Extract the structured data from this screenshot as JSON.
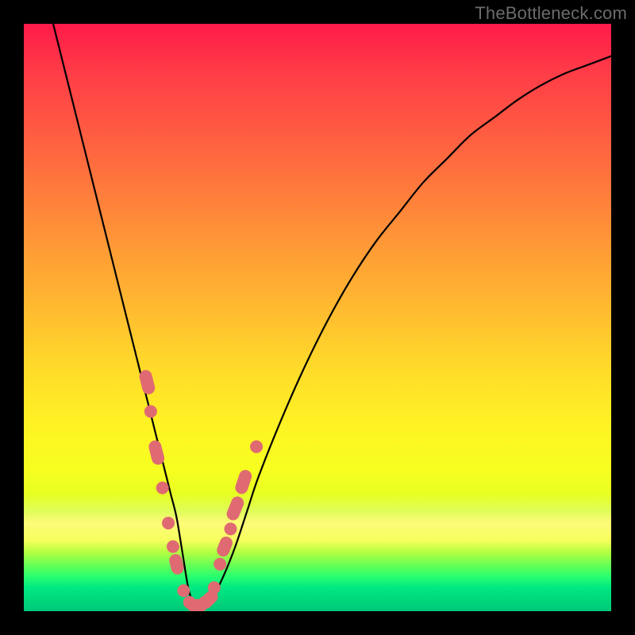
{
  "watermark": "TheBottleneck.com",
  "colors": {
    "background": "#000000",
    "gradient_top": "#ff1a4a",
    "gradient_bottom": "#00c878",
    "curve": "#000000",
    "markers": "#e06a72"
  },
  "chart_data": {
    "type": "line",
    "title": "",
    "xlabel": "",
    "ylabel": "",
    "xlim": [
      0,
      100
    ],
    "ylim": [
      0,
      100
    ],
    "grid": false,
    "series": [
      {
        "name": "curve",
        "x": [
          5,
          7,
          9,
          11,
          13,
          15,
          17,
          19,
          21,
          22,
          23,
          24,
          25,
          26,
          27,
          28,
          29,
          30,
          31,
          32,
          34,
          36,
          38,
          40,
          44,
          48,
          52,
          56,
          60,
          64,
          68,
          72,
          76,
          80,
          84,
          88,
          92,
          96,
          100
        ],
        "y": [
          100,
          92,
          84,
          76,
          68,
          60,
          52,
          44,
          36,
          32,
          28,
          24,
          20,
          16,
          10,
          4,
          1,
          1,
          1,
          2,
          6,
          11,
          17,
          23,
          33,
          42,
          50,
          57,
          63,
          68,
          73,
          77,
          81,
          84,
          87,
          89.5,
          91.5,
          93,
          94.5
        ]
      }
    ],
    "markers": [
      {
        "x": 21.0,
        "y": 39,
        "shape": "pill",
        "len": 6
      },
      {
        "x": 21.6,
        "y": 34,
        "shape": "dot"
      },
      {
        "x": 22.6,
        "y": 27,
        "shape": "pill",
        "len": 6
      },
      {
        "x": 23.6,
        "y": 21,
        "shape": "dot"
      },
      {
        "x": 24.6,
        "y": 15,
        "shape": "dot"
      },
      {
        "x": 25.4,
        "y": 11,
        "shape": "dot"
      },
      {
        "x": 26.0,
        "y": 8,
        "shape": "pill",
        "len": 5
      },
      {
        "x": 27.2,
        "y": 3.5,
        "shape": "dot"
      },
      {
        "x": 28.2,
        "y": 1.5,
        "shape": "dot"
      },
      {
        "x": 28.8,
        "y": 1,
        "shape": "dot"
      },
      {
        "x": 29.5,
        "y": 1,
        "shape": "dot"
      },
      {
        "x": 30.2,
        "y": 1,
        "shape": "dot"
      },
      {
        "x": 30.8,
        "y": 1.5,
        "shape": "dot"
      },
      {
        "x": 31.5,
        "y": 2.0,
        "shape": "pill",
        "len": 5
      },
      {
        "x": 32.4,
        "y": 4,
        "shape": "dot"
      },
      {
        "x": 33.4,
        "y": 8,
        "shape": "dot"
      },
      {
        "x": 34.2,
        "y": 11,
        "shape": "pill",
        "len": 5
      },
      {
        "x": 35.2,
        "y": 14,
        "shape": "dot"
      },
      {
        "x": 36.0,
        "y": 17.5,
        "shape": "pill",
        "len": 6
      },
      {
        "x": 37.4,
        "y": 22,
        "shape": "pill",
        "len": 6
      },
      {
        "x": 39.6,
        "y": 28,
        "shape": "dot"
      }
    ],
    "annotations": []
  }
}
